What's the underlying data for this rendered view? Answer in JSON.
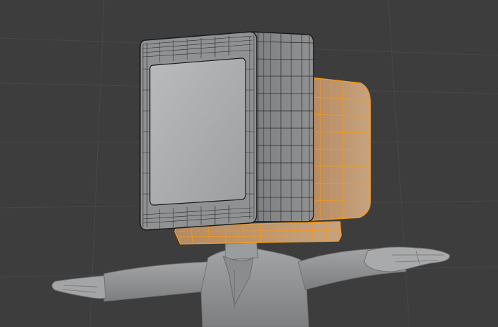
{
  "viewport": {
    "background": "#3d3d3d",
    "grid_color": "#4a4a4a",
    "mesh_base_color": "#8d8f90",
    "mesh_highlight_color": "#b5b7b8",
    "wire_color": "#1b1b1b",
    "selection_color": "#f39a1b",
    "selection_fill": "#c9925b"
  },
  "scene": {
    "objects": [
      {
        "name": "monitor-head",
        "selected": false
      },
      {
        "name": "monitor-back-housing",
        "selected": true
      },
      {
        "name": "monitor-stand-base",
        "selected": true
      },
      {
        "name": "body-mannequin",
        "selected": false
      }
    ]
  }
}
